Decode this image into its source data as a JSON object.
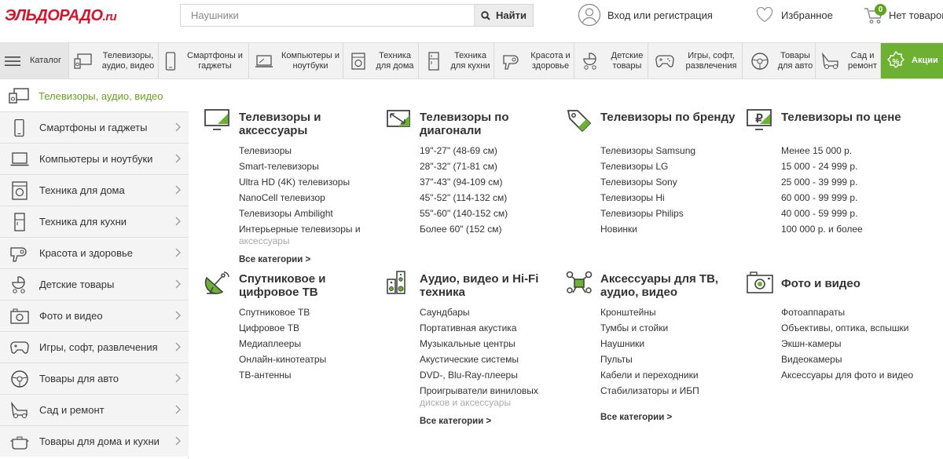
{
  "header": {
    "logo_main": "ЭЛЬДОРАДО",
    "logo_suffix": ".ru",
    "search_placeholder": "Наушники",
    "search_button": "Найти",
    "login_label": "Вход или регистрация",
    "favorites_label": "Избранное",
    "cart_count": "0",
    "cart_label": "Нет товаров"
  },
  "nav": {
    "catalog": "Каталог",
    "items": [
      {
        "label": "Телевизоры, аудио, видео",
        "icon": "tv-audio-icon"
      },
      {
        "label": "Смартфоны и гаджеты",
        "icon": "smartphone-icon"
      },
      {
        "label": "Компьютеры и ноутбуки",
        "icon": "laptop-icon"
      },
      {
        "label": "Техника для дома",
        "icon": "washing-machine-icon"
      },
      {
        "label": "Техника для кухни",
        "icon": "fridge-icon"
      },
      {
        "label": "Красота и здоровье",
        "icon": "hair-dryer-icon"
      },
      {
        "label": "Детские товары",
        "icon": "stroller-icon"
      },
      {
        "label": "Игры, софт, развлечения",
        "icon": "gamepad-icon"
      },
      {
        "label": "Товары для авто",
        "icon": "steering-wheel-icon"
      },
      {
        "label": "Сад и ремонт",
        "icon": "lawn-mower-icon"
      }
    ],
    "promo": "Акции"
  },
  "sidebar": {
    "active": "Телевизоры, аудио, видео",
    "items": [
      {
        "label": "Смартфоны и гаджеты",
        "icon": "smartphone-icon"
      },
      {
        "label": "Компьютеры и ноутбуки",
        "icon": "laptop-icon"
      },
      {
        "label": "Техника для дома",
        "icon": "washing-machine-icon"
      },
      {
        "label": "Техника для кухни",
        "icon": "fridge-icon"
      },
      {
        "label": "Красота и здоровье",
        "icon": "hair-dryer-icon"
      },
      {
        "label": "Детские товары",
        "icon": "stroller-icon"
      },
      {
        "label": "Фото и видео",
        "icon": "camera-icon"
      },
      {
        "label": "Игры, софт, развлечения",
        "icon": "gamepad-icon"
      },
      {
        "label": "Товары для авто",
        "icon": "steering-wheel-icon"
      },
      {
        "label": "Сад и ремонт",
        "icon": "lawn-mower-icon"
      },
      {
        "label": "Товары для дома и кухни",
        "icon": "pot-icon"
      }
    ]
  },
  "menu": {
    "all_categories": "Все категории >",
    "columns": [
      {
        "title": "Телевизоры и аксессуары",
        "links": [
          "Телевизоры",
          "Smart-телевизоры",
          "Ultra HD (4K) телевизоры",
          "NanoCell телевизор",
          "Телевизоры Ambilight"
        ],
        "wrap_line1": "Интерьерные телевизоры и",
        "wrap_line2": "аксессуары"
      },
      {
        "title": "Телевизоры по диагонали",
        "links": [
          "19\"-27\" (48-69 см)",
          "28\"-32\" (71-81 см)",
          "37\"-43\" (94-109 см)",
          "45\"-52\" (114-132 см)",
          "55\"-60\" (140-152 см)",
          "Более 60\" (152 см)"
        ]
      },
      {
        "title": "Телевизоры по бренду",
        "links": [
          "Телевизоры Samsung",
          "Телевизоры LG",
          "Телевизоры Sony",
          "Телевизоры Hi",
          "Телевизоры Philips",
          "Новинки"
        ]
      },
      {
        "title": "Телевизоры по цене",
        "links": [
          "Менее 15 000 р.",
          "15 000 - 24 999 р.",
          "25 000 - 39 999 р.",
          "60 000 - 99 999 р.",
          "40 000 - 59 999 р.",
          "100 000 р. и более"
        ]
      },
      {
        "title": "Спутниковое и цифровое ТВ",
        "links": [
          "Спутниковое ТВ",
          "Цифровое ТВ",
          "Медиаплееры",
          "Онлайн-кинотеатры",
          "ТВ-антенны"
        ]
      },
      {
        "title": "Аудио, видео и Hi-Fi техника",
        "links": [
          "Саундбары",
          "Портативная акустика",
          "Музыкальные центры",
          "Акустические системы",
          "DVD-, Blu-Ray-плееры"
        ],
        "wrap_line1": "Проигрыватели виниловых",
        "wrap_line2": "дисков и аксессуары"
      },
      {
        "title": "Аксессуары для ТВ, аудио, видео",
        "links": [
          "Кронштейны",
          "Тумбы и стойки",
          "Наушники",
          "Пульты",
          "Кабели и переходники",
          "Стабилизаторы и ИБП"
        ]
      },
      {
        "title": "Фото и видео",
        "links": [
          "Фотоаппараты",
          "Объективы, оптика, вспышки",
          "Экшн-камеры",
          "Видеокамеры",
          "Аксессуары для фото и видео"
        ]
      }
    ]
  },
  "colors": {
    "brand_red": "#d0152c",
    "accent_green": "#6db133",
    "active_green": "#6aa11d"
  }
}
